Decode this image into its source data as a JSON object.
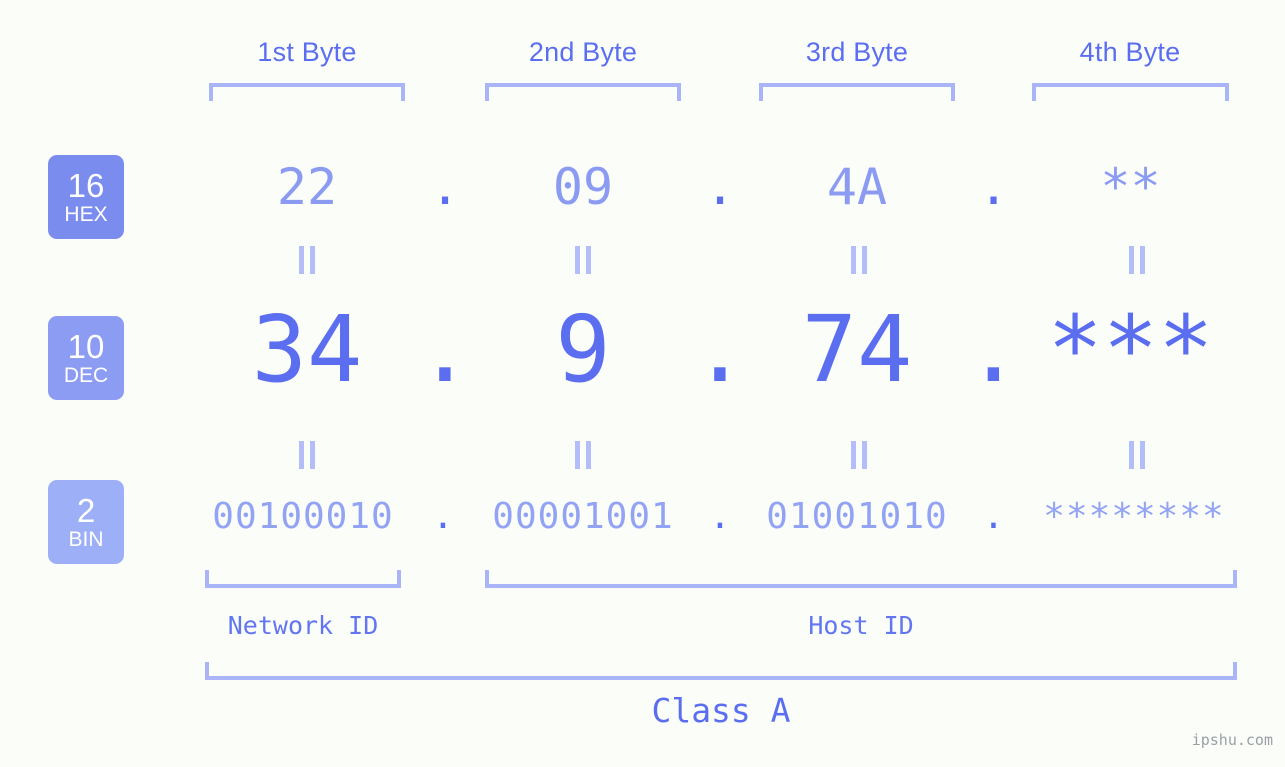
{
  "meta": {
    "background_color": "#fbfdf9",
    "accent_color": "#5b6ef0",
    "light_accent_color": "#aab5f7",
    "watermark": "ipshu.com"
  },
  "byte_headers": [
    {
      "label": "1st Byte"
    },
    {
      "label": "2nd Byte"
    },
    {
      "label": "3rd Byte"
    },
    {
      "label": "4th Byte"
    }
  ],
  "bases": [
    {
      "number": "16",
      "name": "HEX",
      "color": "#7b8cef"
    },
    {
      "number": "10",
      "name": "DEC",
      "color": "#8d9cf3"
    },
    {
      "number": "2",
      "name": "BIN",
      "color": "#9db0f7"
    }
  ],
  "rows": {
    "hex": {
      "base": "16",
      "base_name": "HEX",
      "values": [
        "22",
        "09",
        "4A",
        "**"
      ],
      "separators": [
        ".",
        ".",
        "."
      ]
    },
    "dec": {
      "base": "10",
      "base_name": "DEC",
      "values": [
        "34",
        "9",
        "74",
        "***"
      ],
      "separators": [
        ".",
        ".",
        "."
      ]
    },
    "bin": {
      "base": "2",
      "base_name": "BIN",
      "values": [
        "00100010",
        "00001001",
        "01001010",
        "********"
      ],
      "separators": [
        ".",
        ".",
        "."
      ]
    }
  },
  "equality_marks": {
    "glyph": "||",
    "count_per_row": 4
  },
  "segments": {
    "network_id": "Network ID",
    "host_id": "Host ID",
    "class": "Class A"
  }
}
